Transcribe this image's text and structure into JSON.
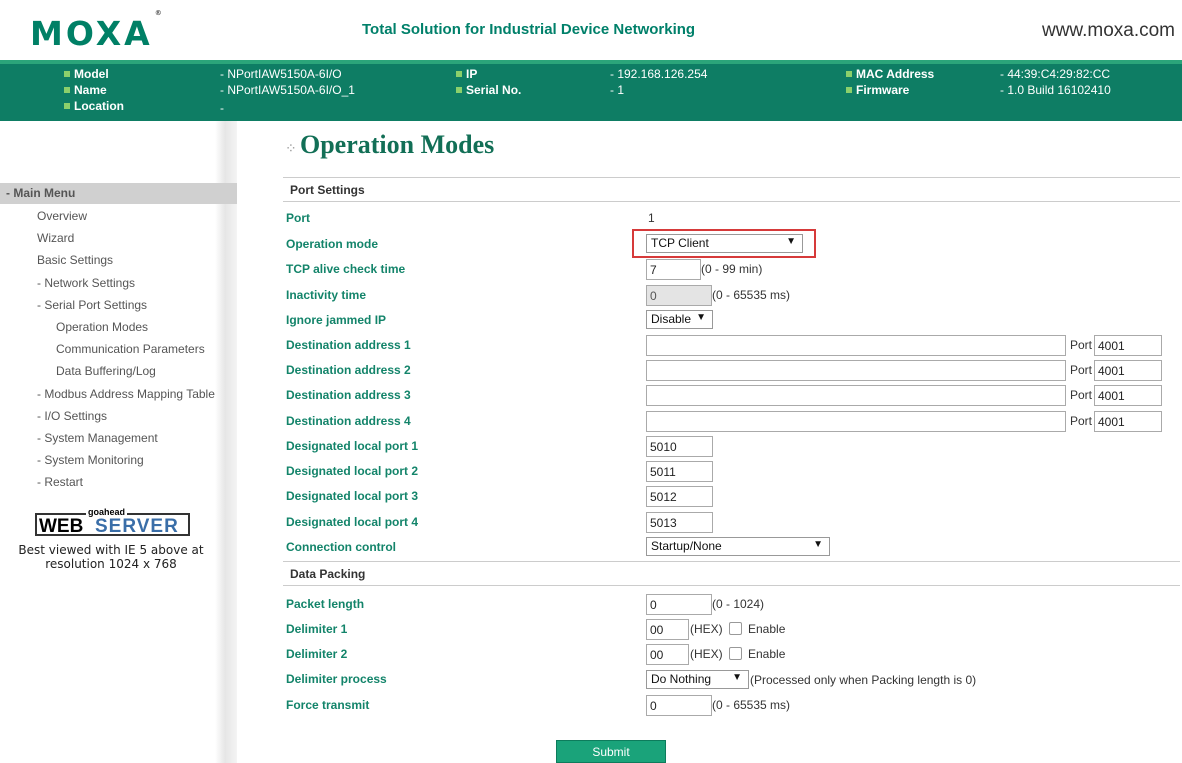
{
  "header": {
    "logo": "MOXA",
    "logo_mark": "®",
    "tagline": "Total Solution for Industrial Device Networking",
    "site": "www.moxa.com"
  },
  "info": {
    "model_label": "Model",
    "model_value": "- NPortIAW5150A-6I/O",
    "name_label": "Name",
    "name_value": "- NPortIAW5150A-6I/O_1",
    "location_label": "Location",
    "location_value": "-",
    "ip_label": "IP",
    "ip_value": "- 192.168.126.254",
    "serial_label": "Serial No.",
    "serial_value": "- 1",
    "mac_label": "MAC Address",
    "mac_value": "- 44:39:C4:29:82:CC",
    "firmware_label": "Firmware",
    "firmware_value": "- 1.0 Build 16102410"
  },
  "sidebar": {
    "head": "- Main Menu",
    "items": [
      "Overview",
      "Wizard",
      "Basic Settings",
      "- Network Settings",
      "- Serial Port Settings",
      "Operation Modes",
      "Communication Parameters",
      "Data Buffering/Log",
      "- Modbus Address Mapping Table",
      "- I/O Settings",
      "- System Management",
      "- System Monitoring",
      "- Restart"
    ],
    "badge_top": "goahead",
    "badge_web": "WEB",
    "badge_server": "SERVER",
    "best_line1": "Best viewed with IE 5 above at",
    "best_line2": "resolution 1024 x 768"
  },
  "main": {
    "title": "Operation Modes",
    "port_settings": "Port Settings",
    "port_label": "Port",
    "port_value": "1",
    "op_mode_label": "Operation mode",
    "op_mode_value": "TCP Client",
    "tcp_alive_label": "TCP alive check time",
    "tcp_alive_value": "7",
    "tcp_alive_hint": "(0 - 99 min)",
    "inactivity_label": "Inactivity time",
    "inactivity_value": "0",
    "inactivity_hint": "(0 - 65535 ms)",
    "ignore_label": "Ignore jammed IP",
    "ignore_value": "Disable",
    "dest1_label": "Destination address 1",
    "dest2_label": "Destination address 2",
    "dest3_label": "Destination address 3",
    "dest4_label": "Destination address 4",
    "dest_port_label": "Port",
    "dest1_port": "4001",
    "dest2_port": "4001",
    "dest3_port": "4001",
    "dest4_port": "4001",
    "dest1_value": "",
    "dest2_value": "",
    "dest3_value": "",
    "dest4_value": "",
    "lp1_label": "Designated local port 1",
    "lp1_value": "5010",
    "lp2_label": "Designated local port 2",
    "lp2_value": "5011",
    "lp3_label": "Designated local port 3",
    "lp3_value": "5012",
    "lp4_label": "Designated local port 4",
    "lp4_value": "5013",
    "conn_label": "Connection control",
    "conn_value": "Startup/None",
    "data_packing": "Data Packing",
    "pkt_label": "Packet length",
    "pkt_value": "0",
    "pkt_hint": "(0 - 1024)",
    "d1_label": "Delimiter 1",
    "d1_value": "00",
    "d1_hex": "(HEX)",
    "d1_enable": "Enable",
    "d2_label": "Delimiter 2",
    "d2_value": "00",
    "d2_hex": "(HEX)",
    "d2_enable": "Enable",
    "dp_label": "Delimiter process",
    "dp_value": "Do Nothing",
    "dp_hint": "(Processed only when Packing length is 0)",
    "ft_label": "Force transmit",
    "ft_value": "0",
    "ft_hint": "(0 - 65535 ms)",
    "submit": "Submit"
  }
}
